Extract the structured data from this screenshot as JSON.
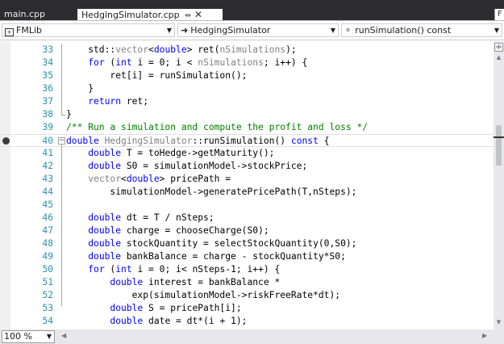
{
  "tabs": [
    {
      "label": "main.cpp",
      "active": false
    },
    {
      "label": "HedgingSimulator.cpp",
      "active": true
    }
  ],
  "tab_overflow_label": "F",
  "nav": {
    "project": "FMLib",
    "class": "HedgingSimulator",
    "member": "runSimulation() const"
  },
  "zoom": "100 %",
  "breakpoint_line": 40,
  "lines": [
    {
      "n": "33",
      "tokens": [
        {
          "t": "    std::"
        },
        {
          "t": "vector",
          "c": "ml"
        },
        {
          "t": "<"
        },
        {
          "t": "double",
          "c": "kw"
        },
        {
          "t": "> ret("
        },
        {
          "t": "nSimulations",
          "c": "ml"
        },
        {
          "t": ");"
        }
      ]
    },
    {
      "n": "34",
      "tokens": [
        {
          "t": "    "
        },
        {
          "t": "for",
          "c": "kw"
        },
        {
          "t": " ("
        },
        {
          "t": "int",
          "c": "kw"
        },
        {
          "t": " i = 0; i < "
        },
        {
          "t": "nSimulations",
          "c": "ml"
        },
        {
          "t": "; i++) {"
        }
      ]
    },
    {
      "n": "35",
      "tokens": [
        {
          "t": "        ret[i] = runSimulation();"
        }
      ]
    },
    {
      "n": "36",
      "tokens": [
        {
          "t": "    }"
        }
      ]
    },
    {
      "n": "37",
      "tokens": [
        {
          "t": "    "
        },
        {
          "t": "return",
          "c": "kw"
        },
        {
          "t": " ret;"
        }
      ]
    },
    {
      "n": "38",
      "tokens": [
        {
          "t": "}"
        }
      ]
    },
    {
      "n": "39",
      "tokens": [
        {
          "t": "/** Run a simulation and compute the profit and loss */",
          "c": "cm"
        }
      ]
    },
    {
      "n": "40",
      "tokens": [
        {
          "t": "double",
          "c": "kw"
        },
        {
          "t": " "
        },
        {
          "t": "HedgingSimulator",
          "c": "ml"
        },
        {
          "t": "::runSimulation() "
        },
        {
          "t": "const",
          "c": "kw"
        },
        {
          "t": " {"
        }
      ]
    },
    {
      "n": "41",
      "tokens": [
        {
          "t": "    "
        },
        {
          "t": "double",
          "c": "kw"
        },
        {
          "t": " T = toHedge->getMaturity();"
        }
      ]
    },
    {
      "n": "42",
      "tokens": [
        {
          "t": "    "
        },
        {
          "t": "double",
          "c": "kw"
        },
        {
          "t": " S0 = simulationModel->stockPrice;"
        }
      ]
    },
    {
      "n": "43",
      "tokens": [
        {
          "t": "    "
        },
        {
          "t": "vector",
          "c": "ml"
        },
        {
          "t": "<"
        },
        {
          "t": "double",
          "c": "kw"
        },
        {
          "t": "> pricePath ="
        }
      ]
    },
    {
      "n": "44",
      "tokens": [
        {
          "t": "        simulationModel->generatePricePath(T,nSteps);"
        }
      ]
    },
    {
      "n": "45",
      "tokens": []
    },
    {
      "n": "46",
      "tokens": [
        {
          "t": "    "
        },
        {
          "t": "double",
          "c": "kw"
        },
        {
          "t": " dt = T / nSteps;"
        }
      ]
    },
    {
      "n": "47",
      "tokens": [
        {
          "t": "    "
        },
        {
          "t": "double",
          "c": "kw"
        },
        {
          "t": " charge = chooseCharge(S0);"
        }
      ]
    },
    {
      "n": "48",
      "tokens": [
        {
          "t": "    "
        },
        {
          "t": "double",
          "c": "kw"
        },
        {
          "t": " stockQuantity = selectStockQuantity(0,S0);"
        }
      ]
    },
    {
      "n": "49",
      "tokens": [
        {
          "t": "    "
        },
        {
          "t": "double",
          "c": "kw"
        },
        {
          "t": " bankBalance = charge - stockQuantity*S0;"
        }
      ]
    },
    {
      "n": "50",
      "tokens": [
        {
          "t": "    "
        },
        {
          "t": "for",
          "c": "kw"
        },
        {
          "t": " ("
        },
        {
          "t": "int",
          "c": "kw"
        },
        {
          "t": " i = 0; i< nSteps-1; i++) {"
        }
      ]
    },
    {
      "n": "51",
      "tokens": [
        {
          "t": "        "
        },
        {
          "t": "double",
          "c": "kw"
        },
        {
          "t": " interest = bankBalance *"
        }
      ]
    },
    {
      "n": "52",
      "tokens": [
        {
          "t": "            exp(simulationModel->riskFreeRate*dt);"
        }
      ]
    },
    {
      "n": "53",
      "tokens": [
        {
          "t": "        "
        },
        {
          "t": "double",
          "c": "kw"
        },
        {
          "t": " S = pricePath[i];"
        }
      ]
    },
    {
      "n": "54",
      "tokens": [
        {
          "t": "        "
        },
        {
          "t": "double",
          "c": "kw"
        },
        {
          "t": " date = dt*(i + 1);"
        }
      ]
    }
  ]
}
